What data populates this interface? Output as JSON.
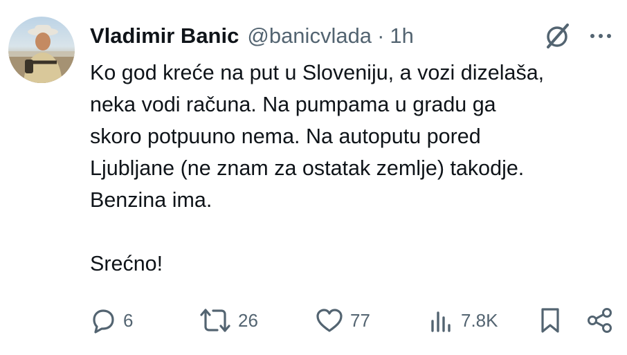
{
  "tweet": {
    "author": {
      "display_name": "Vladimir Banic",
      "handle": "@banicvlada",
      "separator": "·",
      "timestamp": "1h"
    },
    "text_lines": [
      "Ko god kreće na put u Sloveniju, a vozi dizelaša,",
      "neka vodi računa. Na pumpama u gradu ga",
      "skoro potpuuno nema. Na autoputu pored",
      "Ljubljane (ne znam za ostatak zemlje) takodje.",
      "Benzina ima.",
      "",
      "Srećno!"
    ],
    "actions": {
      "replies": "6",
      "reposts": "26",
      "likes": "77",
      "views": "7.8K"
    },
    "icons": {
      "reply": "reply-bubble-icon",
      "repost": "repost-icon",
      "like": "heart-icon",
      "views": "bar-chart-icon",
      "bookmark": "bookmark-icon",
      "share": "share-icon",
      "grok": "grok-icon",
      "more": "more-dots-icon"
    },
    "colors": {
      "text": "#0f1419",
      "secondary": "#536471",
      "background": "#ffffff"
    }
  }
}
